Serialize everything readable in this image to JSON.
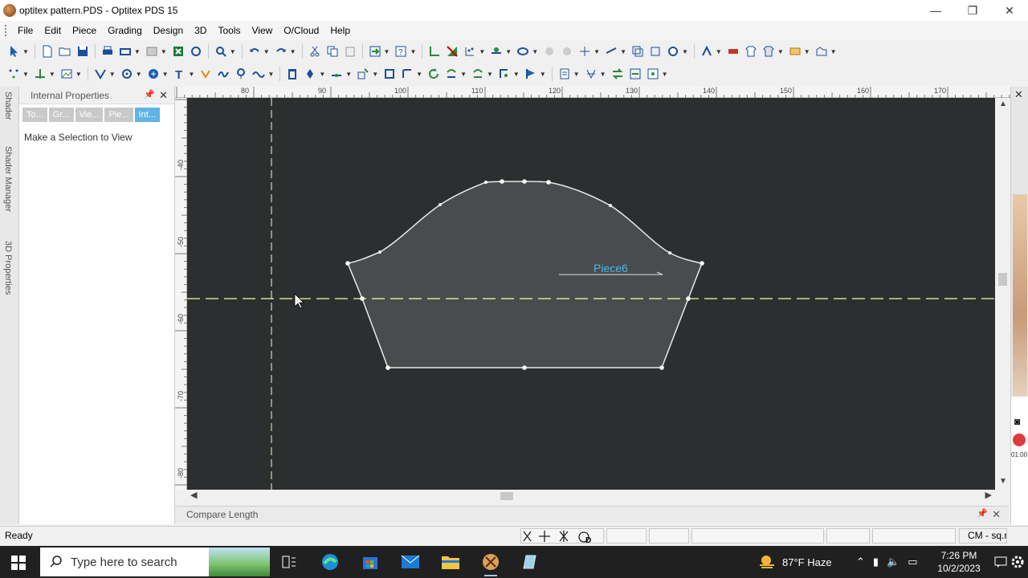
{
  "window": {
    "title": "optitex pattern.PDS - Optitex PDS 15",
    "minimize": "—",
    "maximize": "❐",
    "close": "✕"
  },
  "menu": [
    "File",
    "Edit",
    "Piece",
    "Grading",
    "Design",
    "3D",
    "Tools",
    "View",
    "O/Cloud",
    "Help"
  ],
  "side_tabs": [
    "Shader",
    "Shader Manager",
    "3D Properties"
  ],
  "properties_panel": {
    "title": "Internal Properties",
    "tabs": [
      "To...",
      "Gr...",
      "Vie...",
      "Pie...",
      "Int..."
    ],
    "active_tab": 4,
    "message": "Make a Selection to View Properties"
  },
  "ruler": {
    "h_labels": [
      "80",
      "90",
      "100",
      "110",
      "120",
      "130",
      "140",
      "150",
      "160",
      "170"
    ],
    "v_labels": [
      "-40",
      "-50",
      "-60",
      "-70",
      "-80"
    ]
  },
  "canvas": {
    "background": "#2c2f30",
    "piece_label": "Piece6",
    "label_color": "#4db8e8",
    "guide_color": "#d8d8a0"
  },
  "compare_panel": {
    "title": "Compare Length"
  },
  "status": {
    "text": "Ready",
    "units": "CM - sq.m"
  },
  "taskbar": {
    "search_placeholder": "Type here to search",
    "weather": "87°F  Haze",
    "time": "7:26 PM",
    "date": "10/2/2023"
  }
}
